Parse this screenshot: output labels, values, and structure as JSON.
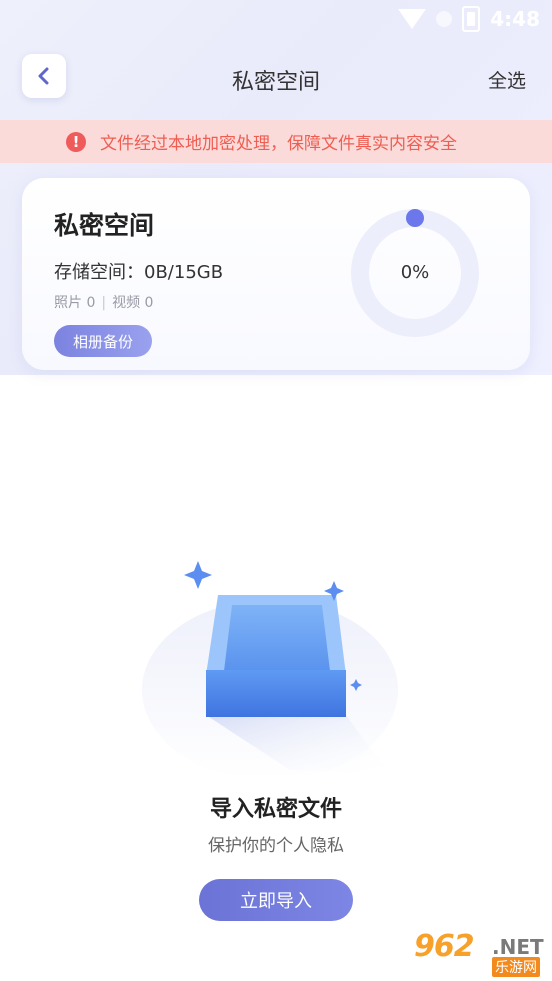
{
  "status_bar": {
    "time": "4:48"
  },
  "header": {
    "title": "私密空间",
    "select_all": "全选"
  },
  "notice": {
    "icon": "!",
    "text": "文件经过本地加密处理，保障文件真实内容安全"
  },
  "card": {
    "title": "私密空间",
    "storage": "存储空间：0B/15GB",
    "photos": "照片 0",
    "separator": "|",
    "videos": "视频 0",
    "backup_label": "相册备份",
    "usage_percent": "0%",
    "usage_fraction": 0
  },
  "empty_state": {
    "title": "导入私密文件",
    "subtitle": "保护你的个人隐私",
    "button_label": "立即导入"
  },
  "watermark": {
    "number": "962",
    "net": ".NET",
    "cn": "乐游网"
  },
  "colors": {
    "accent": "#6b73d6",
    "notice_bg": "#fbdada",
    "notice_text": "#ee5e52",
    "ring_track": "#eceefb",
    "ring_dot": "#6b77ea"
  }
}
